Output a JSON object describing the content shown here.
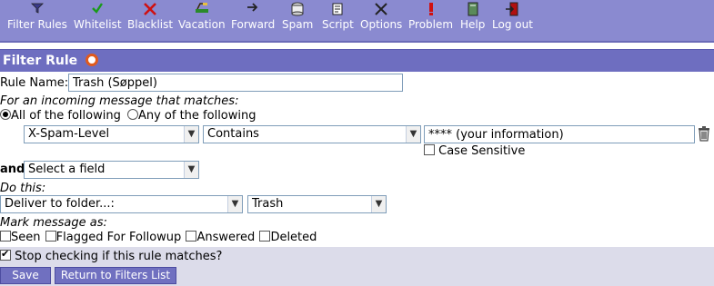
{
  "toolbar": {
    "items": [
      {
        "label": "Filter Rules",
        "icon": "funnel-icon"
      },
      {
        "label": "Whitelist",
        "icon": "checkmark-icon"
      },
      {
        "label": "Blacklist",
        "icon": "red-x-icon"
      },
      {
        "label": "Vacation",
        "icon": "beach-chair-icon"
      },
      {
        "label": "Forward",
        "icon": "arrow-right-icon"
      },
      {
        "label": "Spam",
        "icon": "spam-can-icon"
      },
      {
        "label": "Script",
        "icon": "script-scroll-icon"
      },
      {
        "label": "Options",
        "icon": "tools-icon"
      },
      {
        "label": "Problem",
        "icon": "exclamation-icon"
      },
      {
        "label": "Help",
        "icon": "help-book-icon"
      },
      {
        "label": "Log out",
        "icon": "exit-door-icon"
      }
    ]
  },
  "header": {
    "title": "Filter Rule"
  },
  "form": {
    "rule_name_label": "Rule Name:",
    "rule_name_value": "Trash (Søppel)",
    "incoming_label": "For an incoming message that matches:",
    "all_label": "All of the following",
    "any_label": "Any of the following",
    "condition": {
      "field": "X-Spam-Level",
      "operator": "Contains",
      "value": "**** (your information)",
      "case_sensitive_label": "Case Sensitive"
    },
    "and_label": "and",
    "select_field_placeholder": "Select a field",
    "do_this_label": "Do this:",
    "action": "Deliver to folder...:",
    "folder": "Trash",
    "mark_label": "Mark message as:",
    "marks": {
      "seen": "Seen",
      "flagged": "Flagged For Followup",
      "answered": "Answered",
      "deleted": "Deleted"
    },
    "stop_label": "Stop checking if this rule matches?"
  },
  "buttons": {
    "save": "Save",
    "return": "Return to Filters List"
  },
  "colors": {
    "toolbar": "#8a8ad0",
    "header": "#6e6ec0",
    "button": "#7070c0"
  }
}
